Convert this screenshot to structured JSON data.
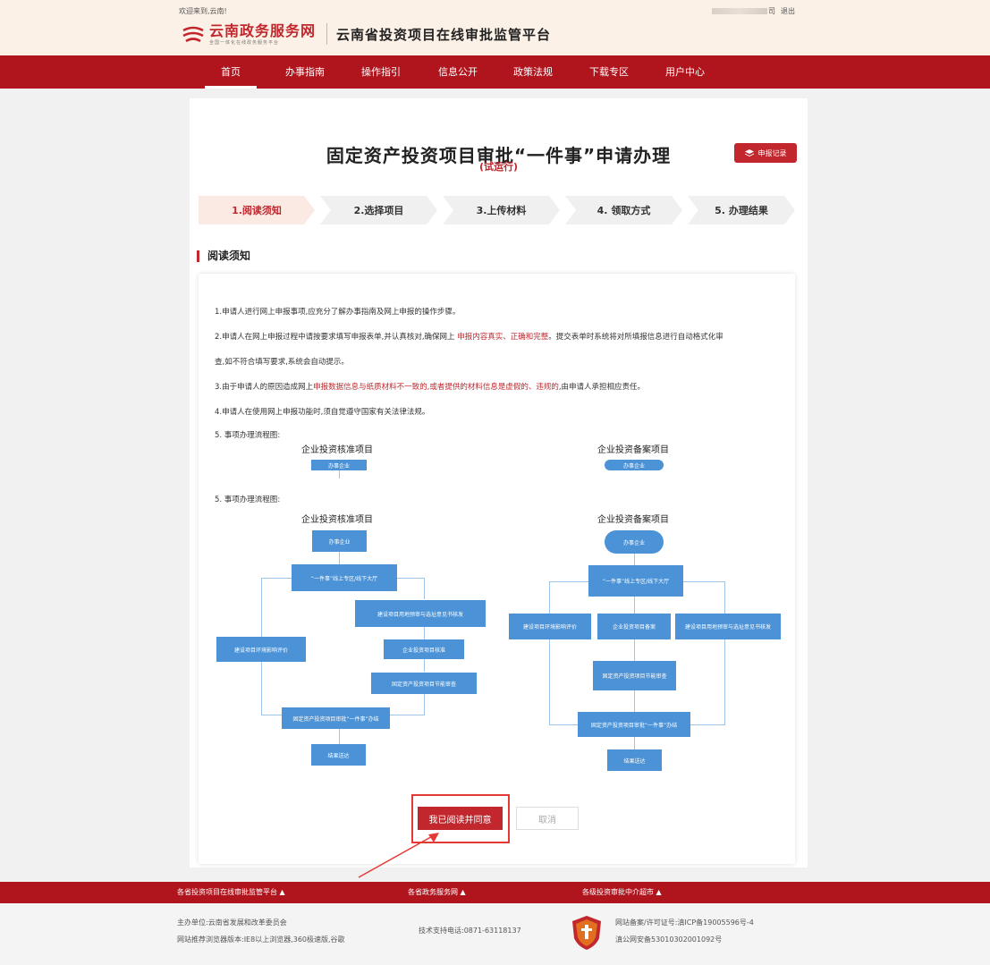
{
  "header": {
    "welcome": "欢迎来到,云南!",
    "user_suffix": "司",
    "logout": "退出",
    "logo_main": "云南政务服务网",
    "logo_sub": "全国一体化在线政务服务平台",
    "platform_title": "云南省投资项目在线审批监管平台"
  },
  "nav": {
    "items": [
      {
        "label": "首页",
        "active": true
      },
      {
        "label": "办事指南"
      },
      {
        "label": "操作指引"
      },
      {
        "label": "信息公开"
      },
      {
        "label": "政策法规"
      },
      {
        "label": "下载专区"
      },
      {
        "label": "用户中心"
      }
    ]
  },
  "main": {
    "title": "固定资产投资项目审批“一件事”申请办理",
    "subtitle": "(试运行)",
    "record_button": "申报记录",
    "steps": [
      "1.阅读须知",
      "2.选择项目",
      "3.上传材料",
      "4. 领取方式",
      "5. 办理结果"
    ],
    "section_title": "阅读须知",
    "notices": {
      "n1": "1.申请人进行网上申报事项,应充分了解办事指南及网上申报的操作步骤。",
      "n2_a": "2.申请人在网上申报过程中请按要求填写申报表单,并认真核对,确保网上 ",
      "n2_hl": "申报内容真实、正确和完整",
      "n2_b": "。提交表单时系统将对所填报信息进行自动格式化审",
      "n2_c": "查,如不符合填写要求,系统会自动提示。",
      "n3_a": "3.由于申请人的原因造成网上",
      "n3_hl": "申报数据信息与纸质材料不一致的,或者提供的材料信息是虚假的、违规的",
      "n3_b": ",由申请人承担相应责任。",
      "n4": "4.申请人在使用网上申报功能时,须自觉遵守国家有关法律法规。",
      "n5": "5. 事项办理流程图:"
    },
    "flow_left": {
      "title": "企业投资核准项目",
      "start": "办事企业",
      "hall": "“一件事”线上专区/线下大厅",
      "land": "建设项目用地预审与选址意见书核发",
      "env": "建设项目环境影响评价",
      "approve": "企业投资项目核准",
      "energy": "固定资产投资项目节能审查",
      "done": "固定资产投资项目审批“一件事”办结",
      "deliver": "结果送达"
    },
    "flow_right": {
      "title": "企业投资备案项目",
      "start": "办事企业",
      "hall": "“一件事”线上专区/线下大厅",
      "env": "建设项目环境影响评价",
      "record": "企业投资项目备案",
      "land": "建设项目用地预审与选址意见书核发",
      "energy": "固定资产投资项目节能审查",
      "done": "固定资产投资项目审批“一件事”办结",
      "deliver": "结果送达"
    },
    "agree_button": "我已阅读并同意",
    "cancel_button": "取消"
  },
  "footer": {
    "links": [
      "各省投资项目在线审批监管平台 ▲",
      "各省政务服务网 ▲",
      "各级投资审批中介超市 ▲"
    ],
    "host": "主办单位:云南省发展和改革委员会",
    "browser": "网站推荐浏览器版本:IE8以上浏览器,360极速版,谷歌",
    "support": "技术支持电话:0871-63118137",
    "icp": "网站备案/许可证号:滇ICP备19005596号-4",
    "police": "滇公网安备53010302001092号"
  }
}
